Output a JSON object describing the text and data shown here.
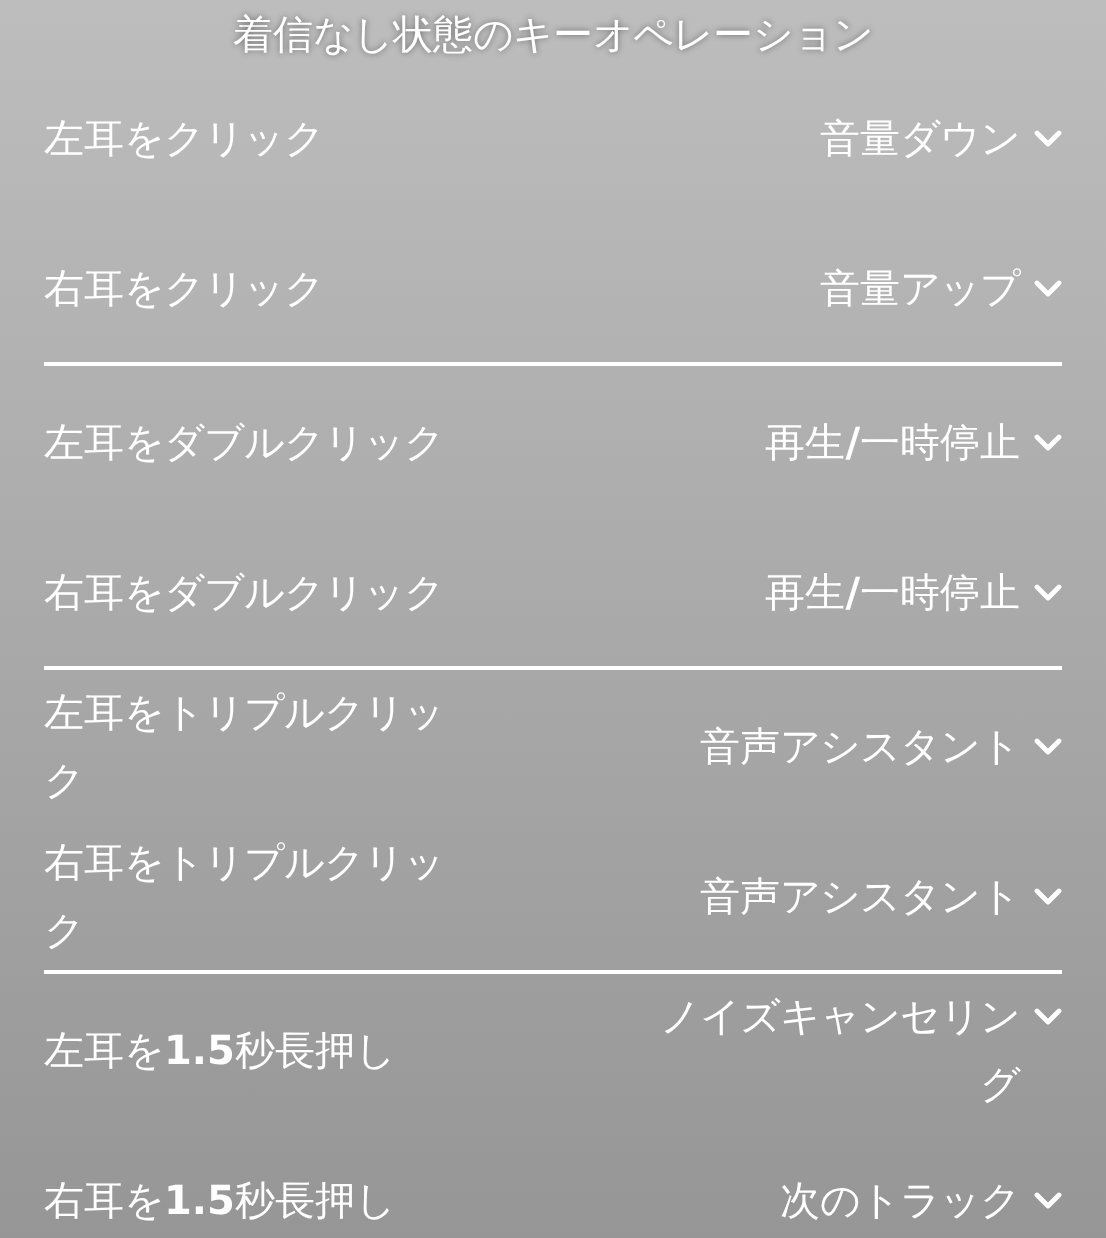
{
  "title": "着信なし状態のキーオペレーション",
  "groups": [
    [
      {
        "action": "左耳をクリック",
        "value": "音量ダウン"
      },
      {
        "action": "右耳をクリック",
        "value": "音量アップ"
      }
    ],
    [
      {
        "action": "左耳をダブルクリック",
        "value": "再生**/**一時停止"
      },
      {
        "action": "右耳をダブルクリック",
        "value": "再生**/**一時停止"
      }
    ],
    [
      {
        "action": "左耳をトリプルクリック",
        "value": "音声アシスタント"
      },
      {
        "action": "右耳をトリプルクリック",
        "value": "音声アシスタント"
      }
    ],
    [
      {
        "action": "左耳を**1.5**秒長押し",
        "value": "ノイズキャンセリング"
      },
      {
        "action": "右耳を**1.5**秒長押し",
        "value": "次のトラック"
      }
    ]
  ]
}
